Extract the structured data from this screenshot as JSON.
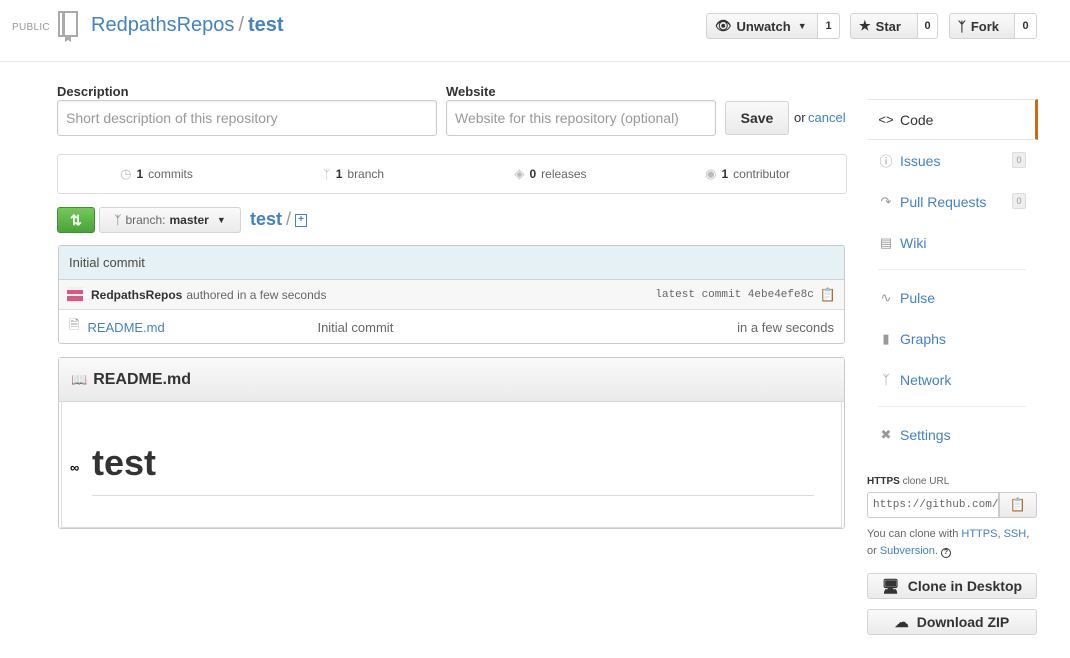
{
  "header": {
    "visibility": "PUBLIC",
    "owner": "RedpathsRepos",
    "separator": "/",
    "repo": "test",
    "unwatch_label": "Unwatch",
    "unwatch_count": "1",
    "star_label": "Star",
    "star_count": "0",
    "fork_label": "Fork",
    "fork_count": "0"
  },
  "edit": {
    "description_label": "Description",
    "description_placeholder": "Short description of this repository",
    "website_label": "Website",
    "website_placeholder": "Website for this repository (optional)",
    "save_label": "Save",
    "or_text": "or",
    "cancel_label": "cancel"
  },
  "summary": {
    "commits_count": "1",
    "commits_label": "commits",
    "branch_count": "1",
    "branch_label": "branch",
    "releases_count": "0",
    "releases_label": "releases",
    "contributor_count": "1",
    "contributor_label": "contributor"
  },
  "branch_bar": {
    "branch_prefix": "branch:",
    "branch_name": "master",
    "crumb": "test",
    "crumb_sep": "/"
  },
  "commit": {
    "message": "Initial commit",
    "author": "RedpathsRepos",
    "authored_text": "authored in a few seconds",
    "sha_text": "latest commit 4ebe4efe8c"
  },
  "files": [
    {
      "name": "README.md",
      "message": "Initial commit",
      "age": "in a few seconds"
    }
  ],
  "readme": {
    "title": "README.md",
    "heading": "test"
  },
  "nav": {
    "code": "Code",
    "issues": "Issues",
    "issues_count": "0",
    "pulls": "Pull Requests",
    "pulls_count": "0",
    "wiki": "Wiki",
    "pulse": "Pulse",
    "graphs": "Graphs",
    "network": "Network",
    "settings": "Settings"
  },
  "clone": {
    "proto": "HTTPS",
    "label": "clone URL",
    "url": "https://github.com/RedpathsRepos/test.git",
    "help_prefix": "You can clone with",
    "https": "HTTPS",
    "ssh": "SSH",
    "or_text": "or",
    "subversion": "Subversion",
    "clone_desktop": "Clone in Desktop",
    "download_zip": "Download ZIP"
  },
  "colors": {
    "link": "#4183c4",
    "active_tab": "#d26911",
    "compare_green": "#4aa33b"
  }
}
